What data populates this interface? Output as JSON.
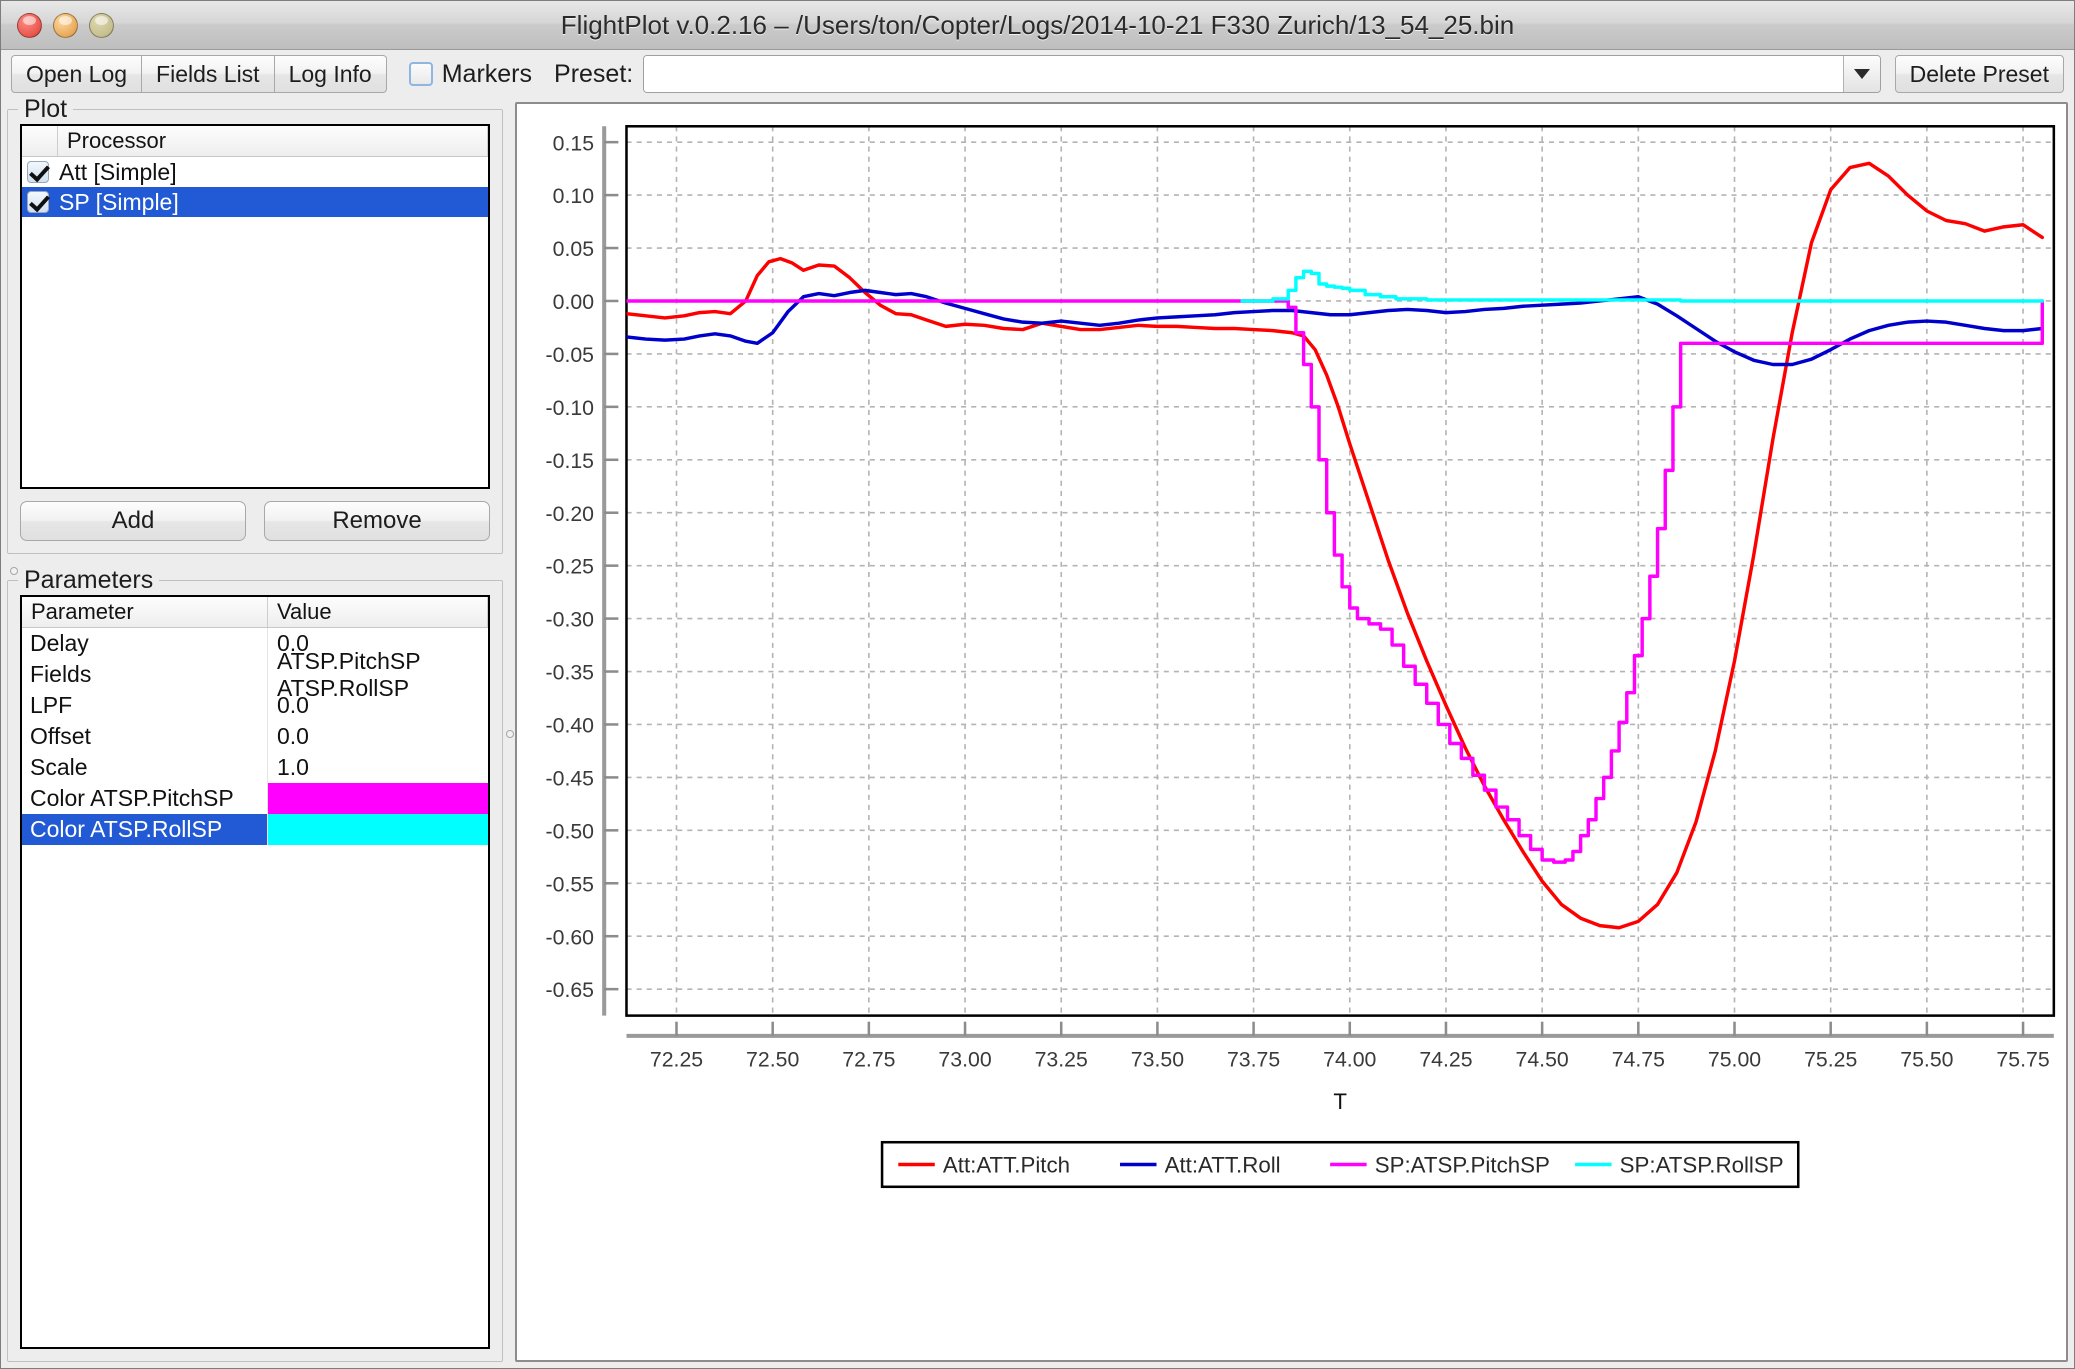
{
  "window": {
    "title": "FlightPlot v.0.2.16 – /Users/ton/Copter/Logs/2014-10-21 F330 Zurich/13_54_25.bin",
    "controls": {
      "close": "close",
      "minimize": "minimize",
      "zoom": "zoom"
    }
  },
  "toolbar": {
    "open_log": "Open Log",
    "fields_list": "Fields List",
    "log_info": "Log Info",
    "markers_label": "Markers",
    "markers_checked": false,
    "preset_label": "Preset:",
    "preset_value": "",
    "preset_placeholder": "",
    "delete_preset": "Delete Preset"
  },
  "plot_panel": {
    "title": "Plot",
    "column_header": "Processor",
    "rows": [
      {
        "label": "Att [Simple]",
        "checked": true,
        "selected": false
      },
      {
        "label": "SP [Simple]",
        "checked": true,
        "selected": true
      }
    ],
    "add_label": "Add",
    "remove_label": "Remove"
  },
  "parameters_panel": {
    "title": "Parameters",
    "headers": {
      "name": "Parameter",
      "value": "Value"
    },
    "rows": [
      {
        "name": "Delay",
        "value": "0.0",
        "type": "text",
        "selected": false
      },
      {
        "name": "Fields",
        "value": "ATSP.PitchSP ATSP.RollSP",
        "type": "text",
        "selected": false
      },
      {
        "name": "LPF",
        "value": "0.0",
        "type": "text",
        "selected": false
      },
      {
        "name": "Offset",
        "value": "0.0",
        "type": "text",
        "selected": false
      },
      {
        "name": "Scale",
        "value": "1.0",
        "type": "text",
        "selected": false
      },
      {
        "name": "Color ATSP.PitchSP",
        "value": "#FF00FF",
        "type": "color",
        "selected": false
      },
      {
        "name": "Color ATSP.RollSP",
        "value": "#00FFFF",
        "type": "color",
        "selected": true
      }
    ]
  },
  "chart_data": {
    "type": "line",
    "title": "",
    "xlabel": "T",
    "ylabel": "",
    "xlim": [
      72.12,
      75.83
    ],
    "ylim": [
      -0.675,
      0.165
    ],
    "xticks": [
      72.25,
      72.5,
      72.75,
      73.0,
      73.25,
      73.5,
      73.75,
      74.0,
      74.25,
      74.5,
      74.75,
      75.0,
      75.25,
      75.5,
      75.75
    ],
    "xtick_labels": [
      "72.25",
      "72.50",
      "72.75",
      "73.00",
      "73.25",
      "73.50",
      "73.75",
      "74.00",
      "74.25",
      "74.50",
      "74.75",
      "75.00",
      "75.25",
      "75.50",
      "75.75"
    ],
    "yticks": [
      0.15,
      0.1,
      0.05,
      0.0,
      -0.05,
      -0.1,
      -0.15,
      -0.2,
      -0.25,
      -0.3,
      -0.35,
      -0.4,
      -0.45,
      -0.5,
      -0.55,
      -0.6,
      -0.65
    ],
    "ytick_labels": [
      "0.15",
      "0.10",
      "0.05",
      "0.00",
      "-0.05",
      "-0.10",
      "-0.15",
      "-0.20",
      "-0.25",
      "-0.30",
      "-0.35",
      "-0.40",
      "-0.45",
      "-0.50",
      "-0.55",
      "-0.60",
      "-0.65"
    ],
    "grid": true,
    "legend_position": "bottom",
    "series": [
      {
        "name": "Att:ATT.Pitch",
        "color": "#FF0000",
        "x": [
          72.12,
          72.17,
          72.22,
          72.27,
          72.31,
          72.35,
          72.39,
          72.43,
          72.46,
          72.49,
          72.52,
          72.55,
          72.58,
          72.62,
          72.66,
          72.7,
          72.74,
          72.78,
          72.82,
          72.86,
          72.9,
          72.95,
          73.0,
          73.05,
          73.1,
          73.15,
          73.2,
          73.25,
          73.3,
          73.35,
          73.4,
          73.45,
          73.5,
          73.55,
          73.6,
          73.65,
          73.7,
          73.75,
          73.8,
          73.85,
          73.88,
          73.91,
          73.94,
          73.97,
          74.0,
          74.05,
          74.1,
          74.15,
          74.2,
          74.25,
          74.3,
          74.35,
          74.4,
          74.45,
          74.5,
          74.55,
          74.6,
          74.65,
          74.7,
          74.75,
          74.8,
          74.85,
          74.9,
          74.95,
          75.0,
          75.05,
          75.1,
          75.15,
          75.2,
          75.25,
          75.3,
          75.35,
          75.4,
          75.45,
          75.5,
          75.55,
          75.6,
          75.65,
          75.7,
          75.75,
          75.8
        ],
        "y": [
          -0.012,
          -0.014,
          -0.016,
          -0.014,
          -0.011,
          -0.01,
          -0.012,
          0.0,
          0.024,
          0.037,
          0.04,
          0.036,
          0.029,
          0.034,
          0.033,
          0.022,
          0.008,
          -0.004,
          -0.012,
          -0.013,
          -0.018,
          -0.024,
          -0.022,
          -0.023,
          -0.026,
          -0.027,
          -0.021,
          -0.024,
          -0.027,
          -0.027,
          -0.025,
          -0.023,
          -0.024,
          -0.024,
          -0.025,
          -0.026,
          -0.026,
          -0.027,
          -0.028,
          -0.03,
          -0.033,
          -0.046,
          -0.07,
          -0.1,
          -0.135,
          -0.19,
          -0.245,
          -0.295,
          -0.34,
          -0.382,
          -0.422,
          -0.458,
          -0.49,
          -0.52,
          -0.548,
          -0.57,
          -0.583,
          -0.59,
          -0.592,
          -0.586,
          -0.57,
          -0.54,
          -0.492,
          -0.425,
          -0.34,
          -0.24,
          -0.13,
          -0.03,
          0.055,
          0.105,
          0.126,
          0.13,
          0.118,
          0.1,
          0.085,
          0.076,
          0.073,
          0.066,
          0.07,
          0.072,
          0.06,
          0.05
        ]
      },
      {
        "name": "Att:ATT.Roll",
        "color": "#0000CC",
        "x": [
          72.12,
          72.17,
          72.22,
          72.27,
          72.31,
          72.35,
          72.39,
          72.43,
          72.46,
          72.5,
          72.54,
          72.58,
          72.62,
          72.66,
          72.7,
          72.74,
          72.78,
          72.82,
          72.86,
          72.9,
          72.95,
          73.0,
          73.05,
          73.1,
          73.15,
          73.2,
          73.25,
          73.3,
          73.35,
          73.4,
          73.45,
          73.5,
          73.55,
          73.6,
          73.65,
          73.7,
          73.75,
          73.8,
          73.85,
          73.9,
          73.95,
          74.0,
          74.05,
          74.1,
          74.15,
          74.2,
          74.25,
          74.3,
          74.35,
          74.4,
          74.45,
          74.5,
          74.55,
          74.6,
          74.65,
          74.7,
          74.75,
          74.8,
          74.85,
          74.9,
          74.95,
          75.0,
          75.05,
          75.1,
          75.15,
          75.2,
          75.25,
          75.3,
          75.35,
          75.4,
          75.45,
          75.5,
          75.55,
          75.6,
          75.65,
          75.7,
          75.75,
          75.8
        ],
        "y": [
          -0.034,
          -0.036,
          -0.037,
          -0.036,
          -0.033,
          -0.031,
          -0.033,
          -0.038,
          -0.04,
          -0.03,
          -0.01,
          0.004,
          0.007,
          0.005,
          0.008,
          0.01,
          0.008,
          0.006,
          0.007,
          0.004,
          -0.002,
          -0.007,
          -0.012,
          -0.017,
          -0.02,
          -0.021,
          -0.019,
          -0.021,
          -0.023,
          -0.021,
          -0.018,
          -0.016,
          -0.015,
          -0.014,
          -0.013,
          -0.011,
          -0.01,
          -0.009,
          -0.009,
          -0.011,
          -0.013,
          -0.013,
          -0.011,
          -0.009,
          -0.008,
          -0.009,
          -0.011,
          -0.01,
          -0.008,
          -0.007,
          -0.005,
          -0.004,
          -0.003,
          -0.002,
          0.0,
          0.002,
          0.004,
          -0.003,
          -0.014,
          -0.026,
          -0.038,
          -0.048,
          -0.056,
          -0.06,
          -0.06,
          -0.055,
          -0.046,
          -0.036,
          -0.028,
          -0.023,
          -0.02,
          -0.019,
          -0.02,
          -0.023,
          -0.026,
          -0.028,
          -0.028,
          -0.026
        ]
      },
      {
        "name": "SP:ATSP.PitchSP",
        "color": "#FF00FF",
        "step": true,
        "x": [
          72.12,
          73.8,
          73.84,
          73.86,
          73.88,
          73.9,
          73.92,
          73.94,
          73.96,
          73.98,
          74.0,
          74.02,
          74.05,
          74.08,
          74.11,
          74.14,
          74.17,
          74.2,
          74.23,
          74.26,
          74.29,
          74.32,
          74.35,
          74.38,
          74.41,
          74.44,
          74.47,
          74.5,
          74.53,
          74.56,
          74.58,
          74.6,
          74.62,
          74.64,
          74.66,
          74.68,
          74.7,
          74.72,
          74.74,
          74.76,
          74.78,
          74.8,
          74.82,
          74.84,
          74.86,
          75.8
        ],
        "y": [
          0.0,
          0.0,
          -0.006,
          -0.03,
          -0.06,
          -0.1,
          -0.15,
          -0.2,
          -0.24,
          -0.27,
          -0.29,
          -0.3,
          -0.305,
          -0.31,
          -0.325,
          -0.345,
          -0.362,
          -0.38,
          -0.4,
          -0.418,
          -0.432,
          -0.448,
          -0.462,
          -0.478,
          -0.49,
          -0.505,
          -0.518,
          -0.528,
          -0.53,
          -0.528,
          -0.52,
          -0.505,
          -0.49,
          -0.47,
          -0.45,
          -0.425,
          -0.398,
          -0.37,
          -0.335,
          -0.3,
          -0.26,
          -0.215,
          -0.16,
          -0.1,
          -0.04,
          0.0
        ]
      },
      {
        "name": "SP:ATSP.RollSP",
        "color": "#00FFFF",
        "step": true,
        "x": [
          73.72,
          73.76,
          73.8,
          73.84,
          73.86,
          73.88,
          73.9,
          73.92,
          73.94,
          73.96,
          73.98,
          74.0,
          74.04,
          74.08,
          74.12,
          74.2,
          74.3,
          74.4,
          74.5,
          74.6,
          74.7,
          74.8,
          74.86,
          75.8
        ],
        "y": [
          0.0,
          0.0,
          0.002,
          0.01,
          0.022,
          0.028,
          0.026,
          0.016,
          0.014,
          0.013,
          0.012,
          0.01,
          0.006,
          0.004,
          0.002,
          0.001,
          0.001,
          0.001,
          0.001,
          0.001,
          0.001,
          0.001,
          0.0,
          0.0
        ]
      }
    ],
    "legend": [
      {
        "label": "Att:ATT.Pitch",
        "color": "#FF0000"
      },
      {
        "label": "Att:ATT.Roll",
        "color": "#0000CC"
      },
      {
        "label": "SP:ATSP.PitchSP",
        "color": "#FF00FF"
      },
      {
        "label": "SP:ATSP.RollSP",
        "color": "#00FFFF"
      }
    ]
  }
}
